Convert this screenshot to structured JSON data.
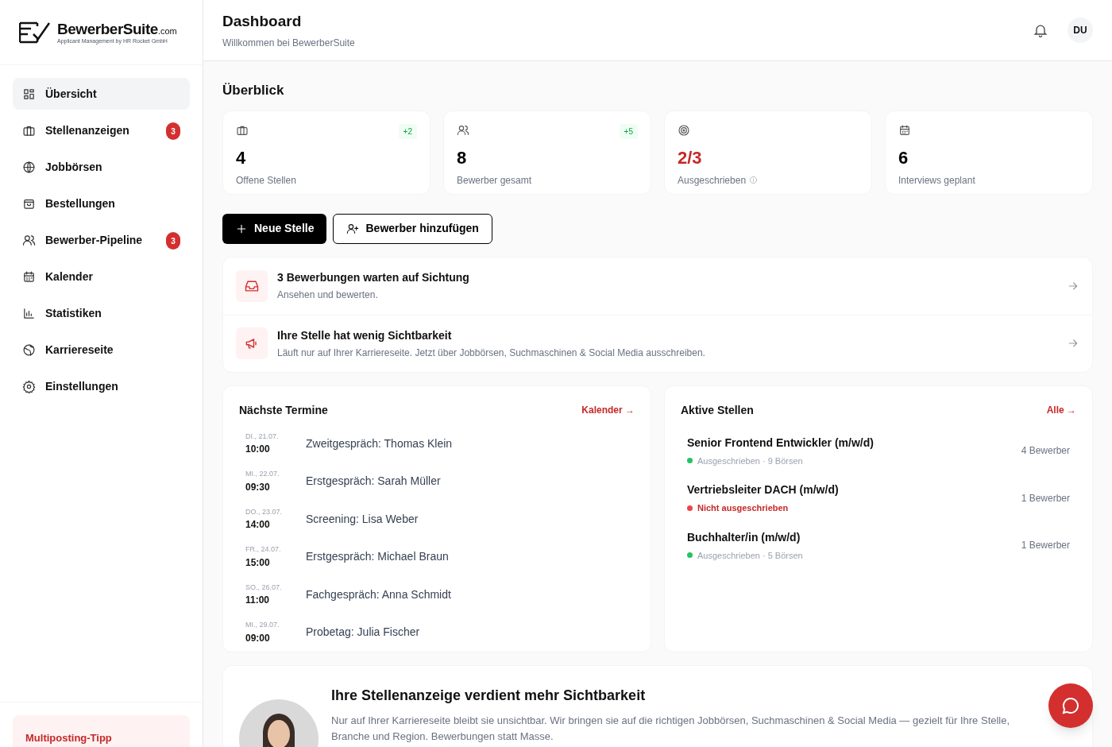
{
  "brand": {
    "name": "BewerberSuite",
    "suffix": ".com",
    "tagline": "Applicant Management by HR Rocket GmbH"
  },
  "nav": [
    {
      "label": "Übersicht",
      "selected": true
    },
    {
      "label": "Stellenanzeigen",
      "selected": false,
      "badge": "3"
    },
    {
      "label": "Jobbörsen",
      "selected": false
    },
    {
      "label": "Bestellungen",
      "selected": false
    },
    {
      "label": "Bewerber-Pipeline",
      "selected": false,
      "badge": "3"
    },
    {
      "label": "Kalender",
      "selected": false
    },
    {
      "label": "Statistiken",
      "selected": false
    },
    {
      "label": "Karriereseite",
      "selected": false
    },
    {
      "label": "Einstellungen",
      "selected": false
    }
  ],
  "sidebar_tip": {
    "title": "Multiposting-Tipp"
  },
  "header": {
    "title": "Dashboard",
    "subtitle": "Willkommen bei BewerberSuite",
    "avatar": "DU"
  },
  "overview": {
    "title": "Überblick",
    "stats": [
      {
        "value": "4",
        "label": "Offene Stellen",
        "delta": "+2",
        "alert": false,
        "info": false
      },
      {
        "value": "8",
        "label": "Bewerber gesamt",
        "delta": "+5",
        "alert": false,
        "info": false
      },
      {
        "value": "2/3",
        "label": "Ausgeschrieben",
        "alert": true,
        "info": true
      },
      {
        "value": "6",
        "label": "Interviews geplant",
        "alert": false,
        "info": false
      }
    ]
  },
  "actions": [
    {
      "label": "Neue Stelle",
      "kind": "primary"
    },
    {
      "label": "Bewerber hinzufügen",
      "kind": "secondary"
    }
  ],
  "notices": [
    {
      "title": "3 Bewerbungen warten auf Sichtung",
      "text": "Ansehen und bewerten."
    },
    {
      "title": "Ihre Stelle hat wenig Sichtbarkeit",
      "text": "Läuft nur auf Ihrer Karriereseite. Jetzt über Jobbörsen, Suchmaschinen & Social Media ausschreiben."
    }
  ],
  "appointments": {
    "title": "Nächste Termine",
    "link": "Kalender →",
    "items": [
      {
        "date": "DI., 21.07.",
        "time": "10:00",
        "title": "Zweitgespräch: Thomas Klein"
      },
      {
        "date": "MI., 22.07.",
        "time": "09:30",
        "title": "Erstgespräch: Sarah Müller"
      },
      {
        "date": "DO., 23.07.",
        "time": "14:00",
        "title": "Screening: Lisa Weber"
      },
      {
        "date": "FR., 24.07.",
        "time": "15:00",
        "title": "Erstgespräch: Michael Braun"
      },
      {
        "date": "SO., 26.07.",
        "time": "11:00",
        "title": "Fachgespräch: Anna Schmidt"
      },
      {
        "date": "MI., 29.07.",
        "time": "09:00",
        "title": "Probetag: Julia Fischer"
      }
    ]
  },
  "jobs": {
    "title": "Aktive Stellen",
    "link": "Alle →",
    "items": [
      {
        "title": "Senior Frontend Entwickler (m/w/d)",
        "status": "Ausgeschrieben · 9 Börsen",
        "color": "#22c55e",
        "kind": "published",
        "applicants": "4 Bewerber"
      },
      {
        "title": "Vertriebsleiter DACH (m/w/d)",
        "status": "Nicht ausgeschrieben",
        "color": "#ef4444",
        "kind": "unpublished",
        "applicants": "1 Bewerber"
      },
      {
        "title": "Buchhalter/in (m/w/d)",
        "status": "Ausgeschrieben · 5 Börsen",
        "color": "#22c55e",
        "kind": "published",
        "applicants": "1 Bewerber"
      }
    ]
  },
  "promo": {
    "title": "Ihre Stellenanzeige verdient mehr Sichtbarkeit",
    "text": "Nur auf Ihrer Karriereseite bleibt sie unsichtbar. Wir bringen sie auf die richtigen Jobbörsen, Suchmaschinen & Social Media — gezielt für Ihre Stelle, Branche und Region. Bewerbungen statt Masse."
  }
}
